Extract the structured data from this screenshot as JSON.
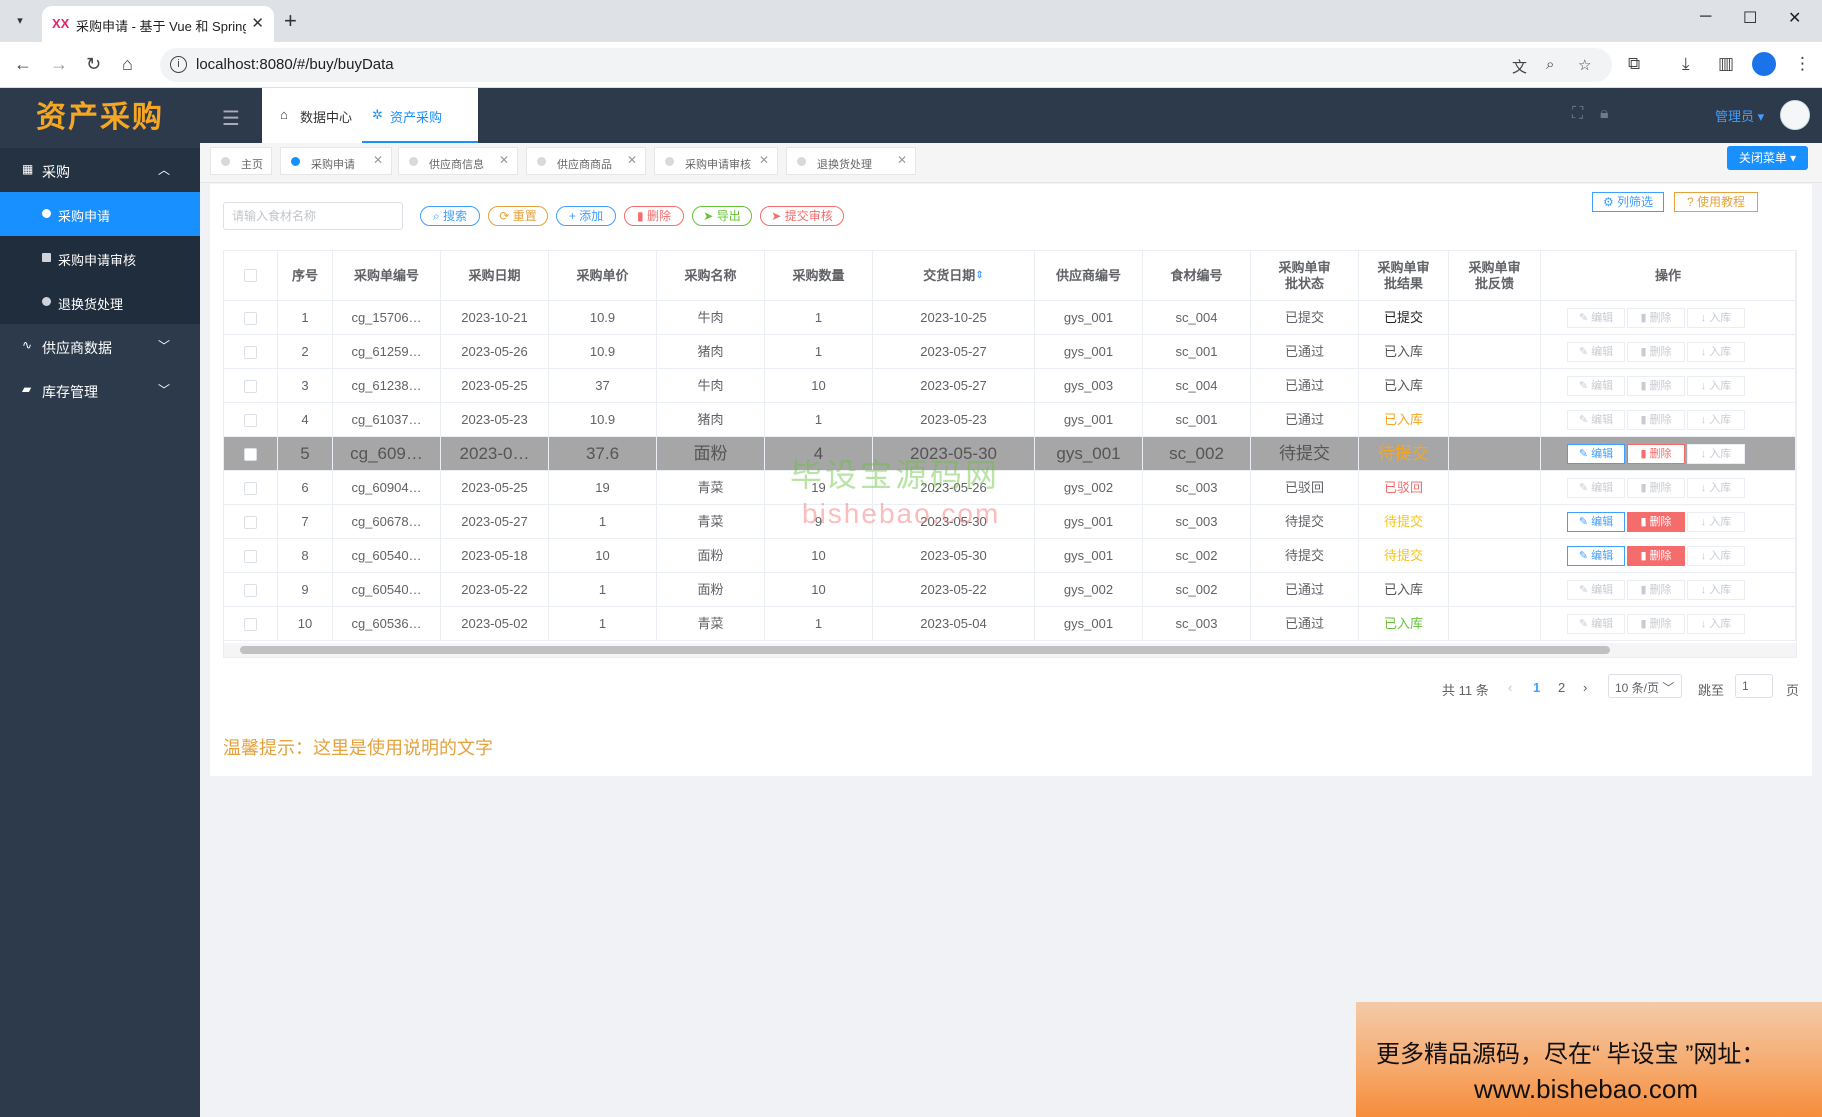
{
  "browser": {
    "tab_title": "采购申请 - 基于 Vue 和 Spring",
    "favicon": "XX",
    "url": "localhost:8080/#/buy/buyData"
  },
  "app": {
    "logo": "资产采购",
    "sidebar": [
      {
        "label": "采购",
        "icon": "grid-icon"
      },
      {
        "label": "采购申请"
      },
      {
        "label": "采购申请审核"
      },
      {
        "label": "退换货处理"
      },
      {
        "label": "供应商数据",
        "icon": "pulse-icon"
      },
      {
        "label": "库存管理",
        "icon": "briefcase-icon"
      }
    ],
    "top_tabs": [
      "数据中心",
      "资产采购"
    ],
    "admin": "管理员",
    "tags": [
      "主页",
      "采购申请",
      "供应商信息",
      "供应商商品",
      "采购申请审核",
      "退换货处理"
    ],
    "close_menu": "关闭菜单"
  },
  "toolbar": {
    "search_placeholder": "请输入食材名称",
    "search": "搜索",
    "reset": "重置",
    "add": "添加",
    "delete": "删除",
    "export": "导出",
    "submit": "提交审核",
    "filter": "列筛选",
    "tutorial": "使用教程"
  },
  "table": {
    "headers": [
      "序号",
      "采购单编号",
      "采购日期",
      "采购单价",
      "采购名称",
      "采购数量",
      "交货日期",
      "供应商编号",
      "食材编号",
      "采购单审批状态",
      "采购单审批结果",
      "采购单审批反馈",
      "操作"
    ],
    "ops": [
      "编辑",
      "删除",
      "入库"
    ],
    "rows": [
      [
        "1",
        "cg_15706…",
        "2023-10-21",
        "10.9",
        "牛肉",
        "1",
        "2023-10-25",
        "gys_001",
        "sc_004",
        "已提交",
        "已提交",
        ""
      ],
      [
        "2",
        "cg_61259…",
        "2023-05-26",
        "10.9",
        "猪肉",
        "1",
        "2023-05-27",
        "gys_001",
        "sc_001",
        "已通过",
        "已入库",
        ""
      ],
      [
        "3",
        "cg_61238…",
        "2023-05-25",
        "37",
        "牛肉",
        "10",
        "2023-05-27",
        "gys_003",
        "sc_004",
        "已通过",
        "已入库",
        ""
      ],
      [
        "4",
        "cg_61037…",
        "2023-05-23",
        "10.9",
        "猪肉",
        "1",
        "2023-05-23",
        "gys_001",
        "sc_001",
        "已通过",
        "已入库",
        ""
      ],
      [
        "5",
        "cg_609…",
        "2023-0…",
        "37.6",
        "面粉",
        "4",
        "2023-05-30",
        "gys_001",
        "sc_002",
        "待提交",
        "待提交",
        ""
      ],
      [
        "6",
        "cg_60904…",
        "2023-05-25",
        "19",
        "青菜",
        "19",
        "2023-05-26",
        "gys_002",
        "sc_003",
        "已驳回",
        "已驳回",
        ""
      ],
      [
        "7",
        "cg_60678…",
        "2023-05-27",
        "1",
        "青菜",
        "9",
        "2023-05-30",
        "gys_001",
        "sc_003",
        "待提交",
        "待提交",
        ""
      ],
      [
        "8",
        "cg_60540…",
        "2023-05-18",
        "10",
        "面粉",
        "10",
        "2023-05-30",
        "gys_001",
        "sc_002",
        "待提交",
        "待提交",
        ""
      ],
      [
        "9",
        "cg_60540…",
        "2023-05-22",
        "1",
        "面粉",
        "10",
        "2023-05-22",
        "gys_002",
        "sc_002",
        "已通过",
        "已入库",
        ""
      ],
      [
        "10",
        "cg_60536…",
        "2023-05-02",
        "1",
        "青菜",
        "1",
        "2023-05-04",
        "gys_001",
        "sc_003",
        "已通过",
        "已入库",
        ""
      ]
    ],
    "result_colors": [
      "#222222",
      "#555555",
      "#555555",
      "#f5a623",
      "#f5a623",
      "#f56c6c",
      "#f5c518",
      "#f5c518",
      "#555555",
      "#67c23a"
    ],
    "editable_rows": [
      false,
      false,
      false,
      false,
      true,
      false,
      true,
      true,
      false,
      false
    ]
  },
  "pager": {
    "total": "共 11 条",
    "pages": [
      "1",
      "2"
    ],
    "size": "10 条/页",
    "goto": "跳至",
    "goto_value": "1",
    "page_unit": "页"
  },
  "tip": "温馨提示：这里是使用说明的文字",
  "watermark": {
    "line1": "毕设宝源码网",
    "line2": "bishebao.com"
  },
  "banner": {
    "line1": "更多精品源码，尽在“ 毕设宝 ”网址：",
    "line2": "www.bishebao.com"
  }
}
